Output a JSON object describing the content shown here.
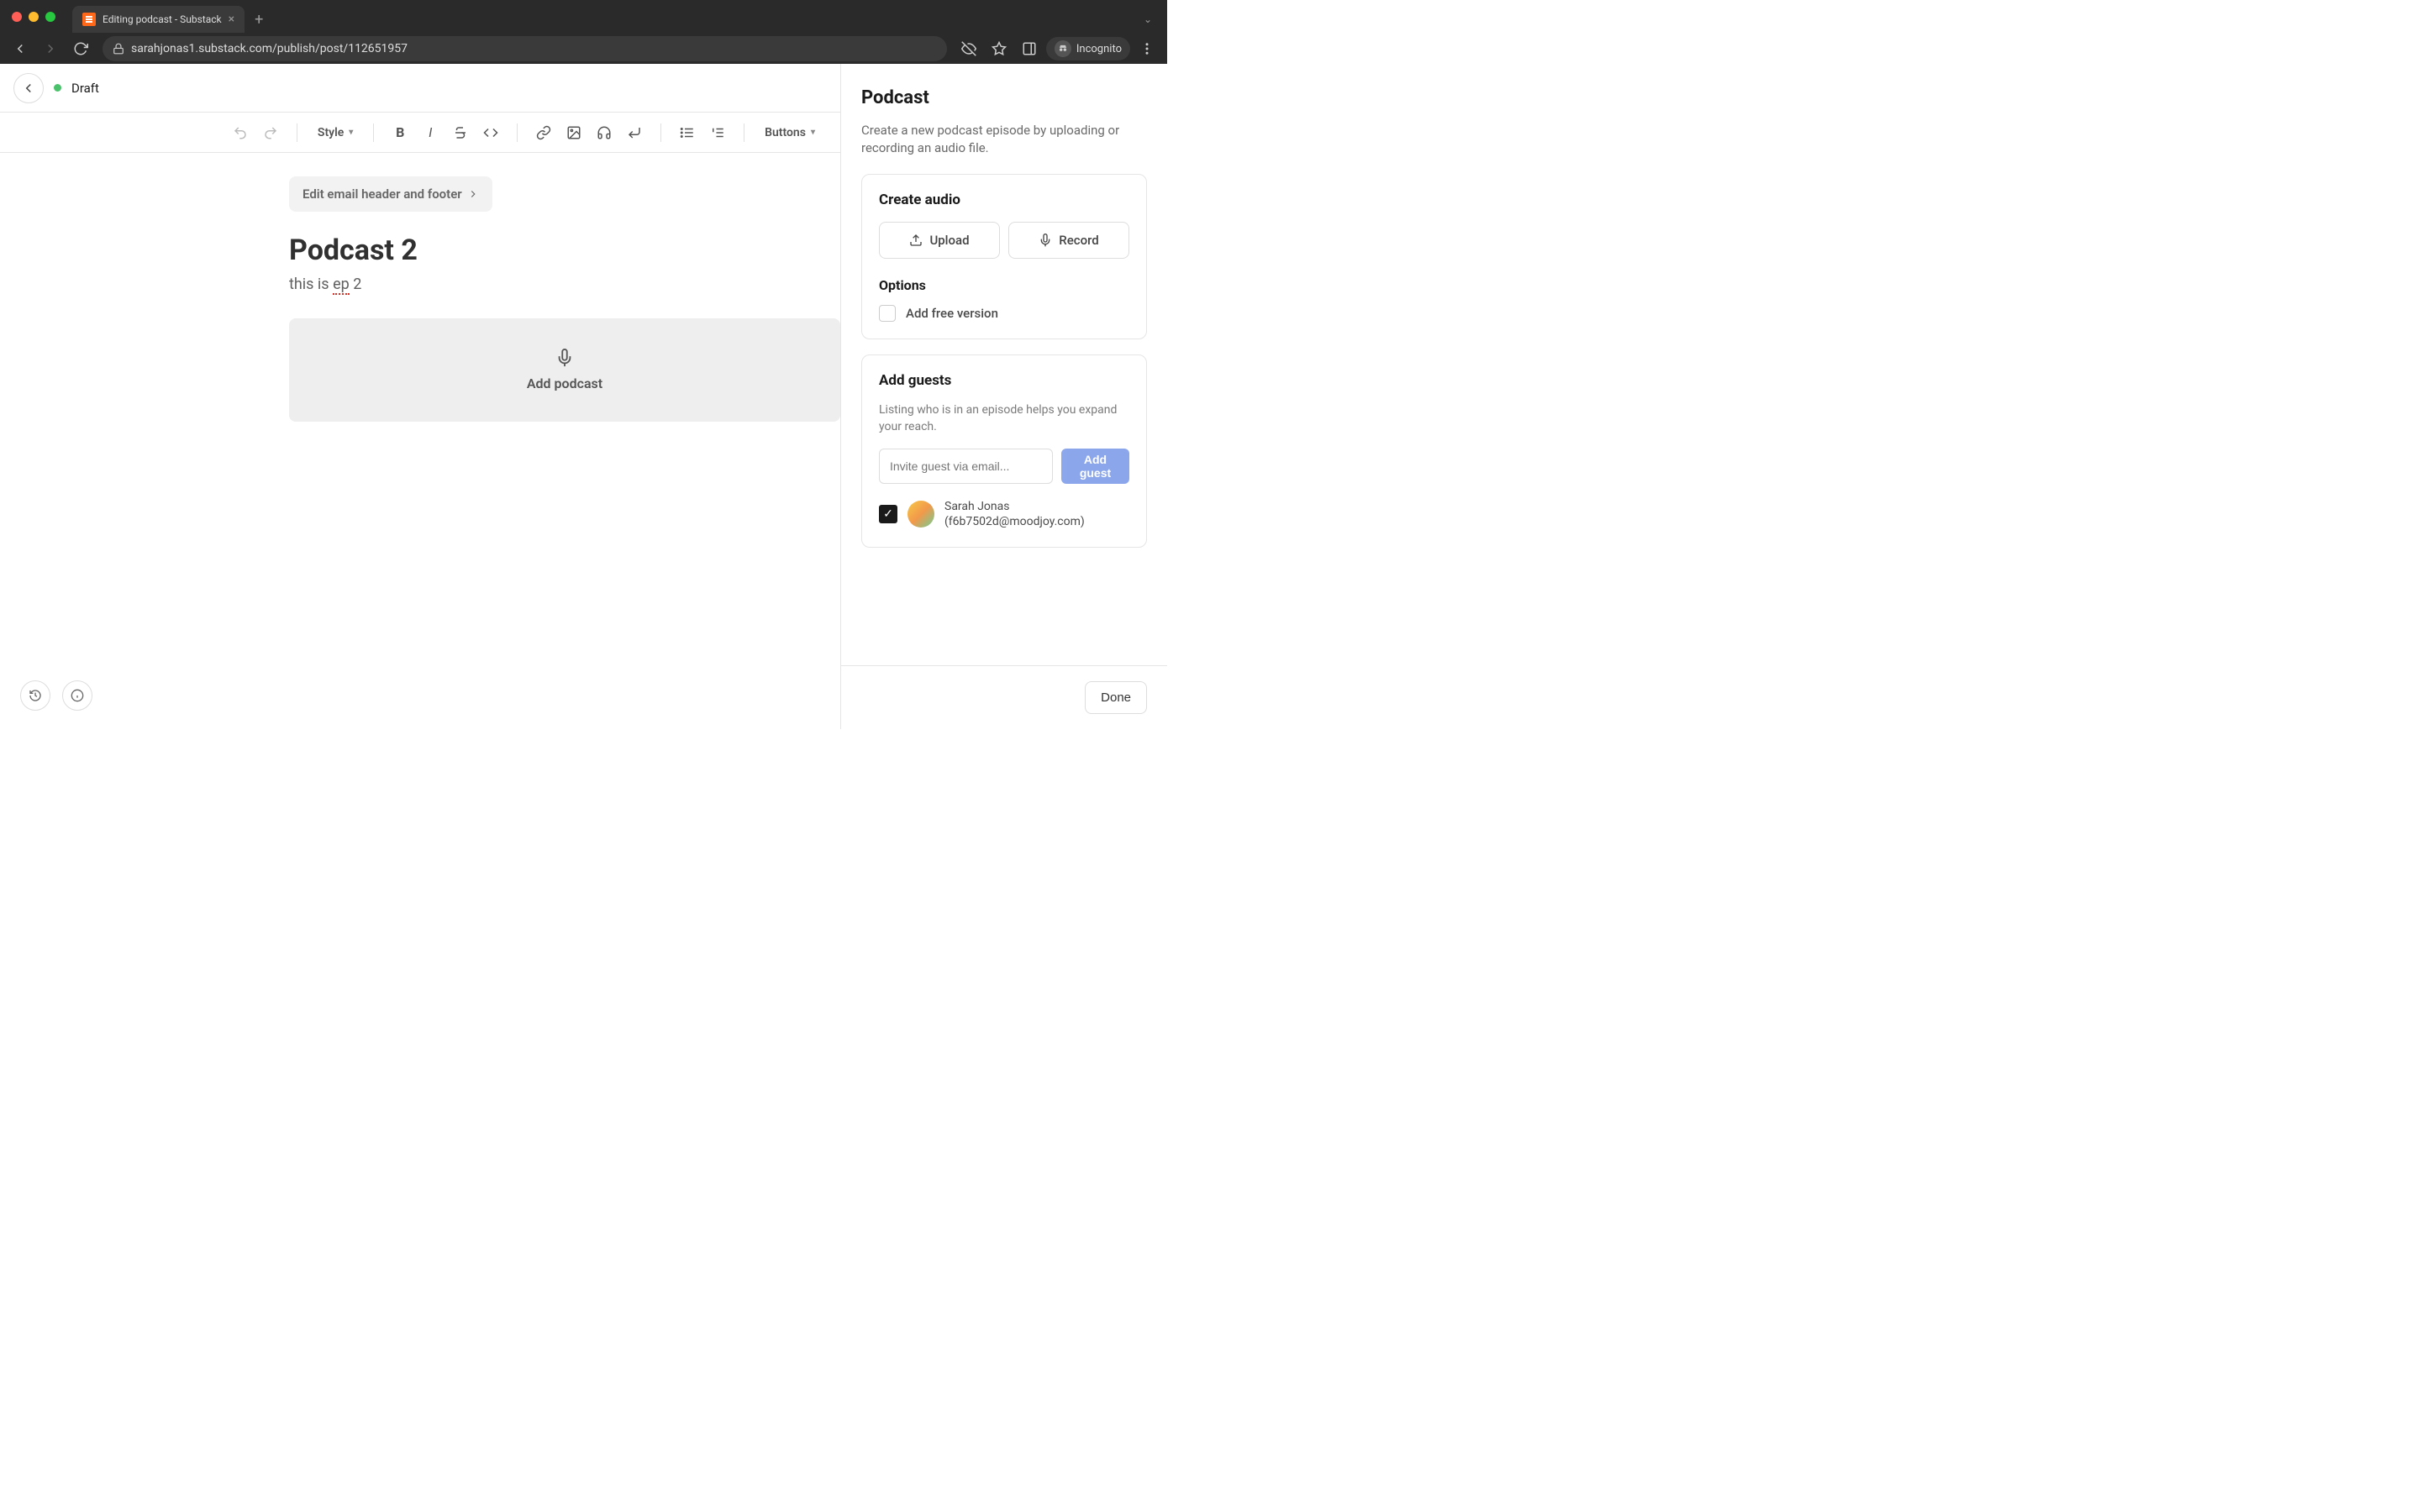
{
  "browser": {
    "tab_title": "Editing podcast - Substack",
    "url": "sarahjonas1.substack.com/publish/post/112651957",
    "incognito_label": "Incognito"
  },
  "header": {
    "status": "Draft"
  },
  "toolbar": {
    "style_label": "Style",
    "buttons_label": "Buttons"
  },
  "editor": {
    "email_header_button": "Edit email header and footer",
    "title": "Podcast 2",
    "subtitle_prefix": "this is ",
    "subtitle_err": "ep",
    "subtitle_suffix": " 2",
    "add_podcast_label": "Add podcast"
  },
  "sidebar": {
    "title": "Podcast",
    "description": "Create a new podcast episode by uploading or recording an audio file.",
    "create_audio": {
      "heading": "Create audio",
      "upload_label": "Upload",
      "record_label": "Record"
    },
    "options": {
      "heading": "Options",
      "free_version_label": "Add free version"
    },
    "guests": {
      "heading": "Add guests",
      "description": "Listing who is in an episode helps you expand your reach.",
      "invite_placeholder": "Invite guest via email...",
      "add_button": "Add guest",
      "list": [
        {
          "name": "Sarah Jonas",
          "email": "f6b7502d@moodjoy.com"
        }
      ]
    },
    "done_label": "Done"
  }
}
